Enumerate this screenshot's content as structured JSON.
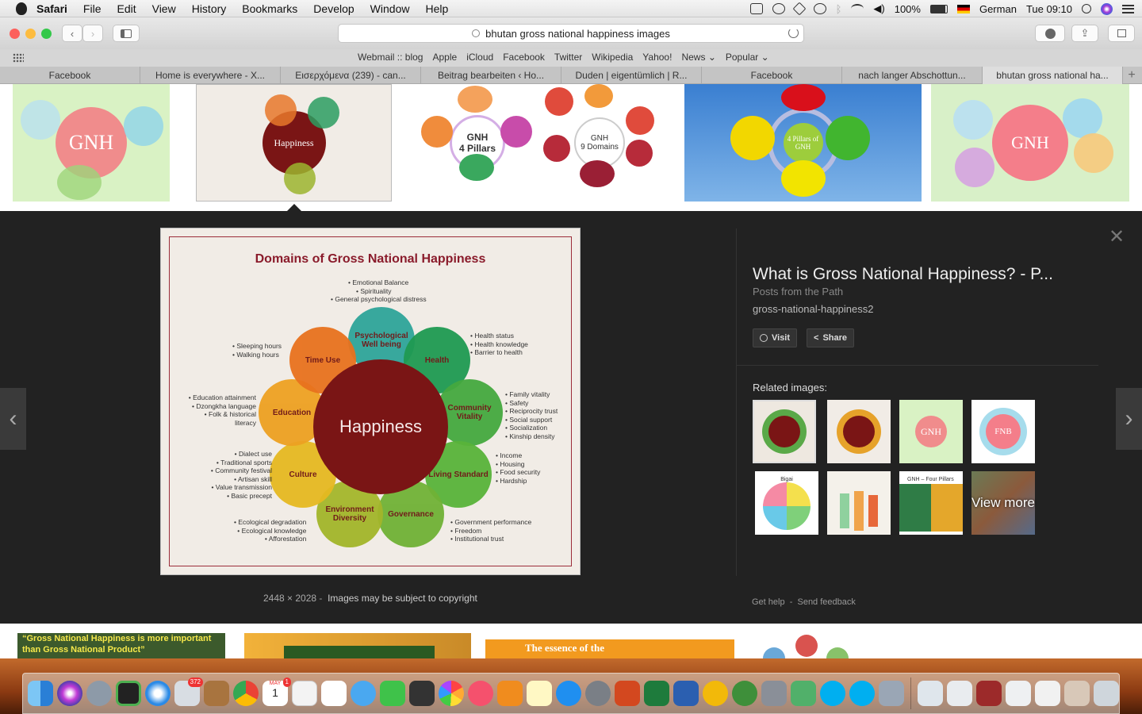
{
  "menubar": {
    "app": "Safari",
    "items": [
      "File",
      "Edit",
      "View",
      "History",
      "Bookmarks",
      "Develop",
      "Window",
      "Help"
    ],
    "battery": "100%",
    "language": "German",
    "clock": "Tue 09:10"
  },
  "toolbar": {
    "url": "bhutan gross national happiness images"
  },
  "favorites": [
    "Webmail :: blog",
    "Apple",
    "iCloud",
    "Facebook",
    "Twitter",
    "Wikipedia",
    "Yahoo!",
    "News",
    "Popular"
  ],
  "tabs": [
    "Facebook",
    "Home is everywhere - X...",
    "Εισερχόμενα (239) - can...",
    "Beitrag bearbeiten ‹ Ho...",
    "Duden | eigentümlich | R...",
    "Facebook",
    "nach langer Abschottun...",
    "bhutan gross national ha..."
  ],
  "strip": {
    "t1": "GNH",
    "t2": "Happiness",
    "t3_title": "GNH",
    "t3_sub": "4 Pillars",
    "t4_title": "GNH",
    "t4_sub": "9 Domains",
    "t5_title": "4 Pillars of GNH",
    "t6": "GNH"
  },
  "viewer": {
    "image_title": "Domains of Gross National Happiness",
    "core": "Happiness",
    "domains": [
      "Psychological Well being",
      "Health",
      "Community Vitality",
      "Living Standard",
      "Governance",
      "Environment Diversity",
      "Culture",
      "Education",
      "Time Use"
    ],
    "bullets": {
      "psych": [
        "• Emotional Balance",
        "• Spirituality",
        "• General psychological distress"
      ],
      "health": [
        "• Health status",
        "• Health knowledge",
        "• Barrier to health"
      ],
      "community": [
        "• Family vitality",
        "• Safety",
        "• Reciprocity trust",
        "• Social support",
        "• Socialization",
        "• Kinship density"
      ],
      "living": [
        "• Income",
        "• Housing",
        "• Food security",
        "• Hardship"
      ],
      "gov": [
        "• Government performance",
        "• Freedom",
        "• Institutional trust"
      ],
      "env": [
        "• Ecological degradation",
        "• Ecological knowledge",
        "• Afforestation"
      ],
      "culture": [
        "• Dialect use",
        "• Traditional sports",
        "• Community festival",
        "• Artisan skill",
        "• Value transmission",
        "• Basic precept"
      ],
      "edu": [
        "• Education attainment",
        "• Dzongkha language",
        "• Folk & historical",
        "literacy"
      ],
      "time": [
        "• Sleeping hours",
        "• Walking hours"
      ]
    },
    "dims": "2448 × 2028",
    "copyright": "Images may be subject to copyright",
    "panel_title": "What is Gross National Happiness? - P...",
    "panel_source": "Posts from the Path",
    "panel_url": "gross-national-happiness2",
    "visit_label": "Visit",
    "share_label": "Share",
    "related_label": "Related images:",
    "view_more": "View more",
    "get_help": "Get help",
    "send_feedback": "Send feedback",
    "rel_texts": [
      "GNH",
      "FNB",
      "Bigai",
      "GNH – Four Pillars"
    ]
  },
  "bottom": {
    "quote": "“Gross National Happiness is more important than Gross National Product”",
    "essence": "The essence of the"
  },
  "dock": {
    "badges": [
      "372",
      "1"
    ],
    "calendar_month": "MAY",
    "calendar_day": "1"
  },
  "colors": {
    "viewer_bg": "#222222",
    "accent_red": "#8a1b2b"
  }
}
